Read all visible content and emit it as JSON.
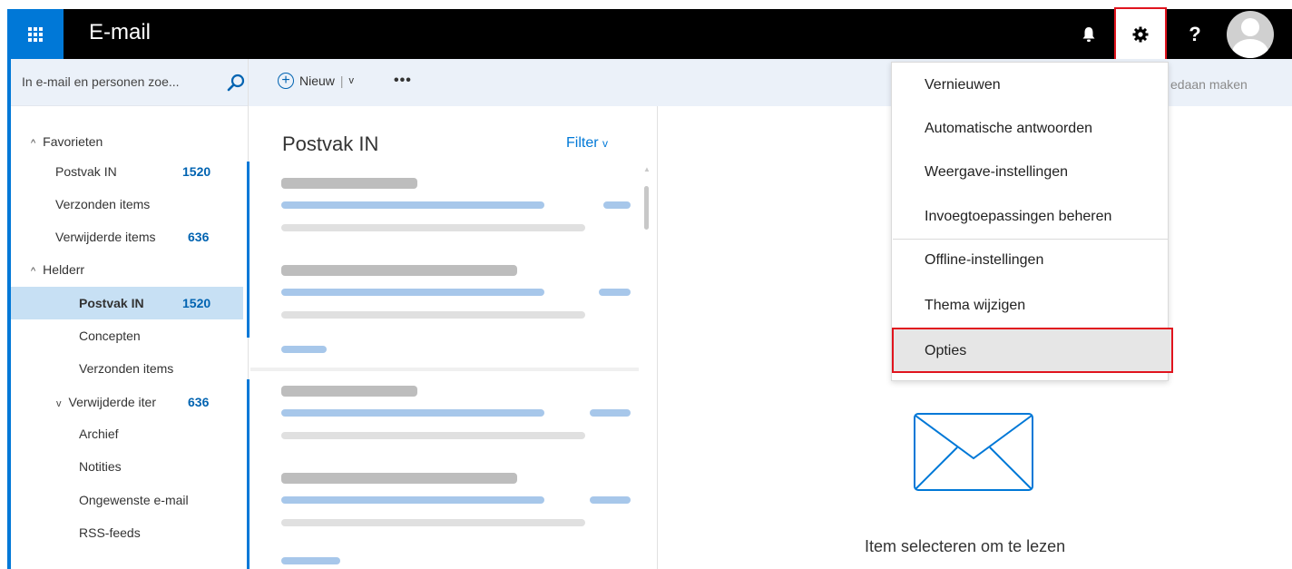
{
  "header": {
    "app_title": "E-mail",
    "icons": [
      "waffle-icon",
      "bell-icon",
      "gear-icon",
      "help-icon",
      "avatar-icon"
    ],
    "help_label": "?"
  },
  "search": {
    "placeholder": "In e-mail en personen zoe..."
  },
  "folders": {
    "favorites_label": "Favorieten",
    "favorites": [
      {
        "label": "Postvak IN",
        "count": "1520"
      },
      {
        "label": "Verzonden items",
        "count": ""
      },
      {
        "label": "Verwijderde items",
        "count": "636"
      }
    ],
    "account_label": "Helderr",
    "account": [
      {
        "label": "Postvak IN",
        "count": "1520"
      },
      {
        "label": "Concepten",
        "count": ""
      },
      {
        "label": "Verzonden items",
        "count": ""
      },
      {
        "label": "Verwijderde iter",
        "count": "636"
      },
      {
        "label": "Archief",
        "count": ""
      },
      {
        "label": "Notities",
        "count": ""
      },
      {
        "label": "Ongewenste e-mail",
        "count": ""
      },
      {
        "label": "RSS-feeds",
        "count": ""
      }
    ]
  },
  "commandbar": {
    "new_label": "Nieuw",
    "more_label": "•••",
    "undo_label": "edaan maken"
  },
  "message_list": {
    "title": "Postvak IN",
    "filter_label": "Filter"
  },
  "reading_pane": {
    "empty_text": "Item selecteren om te lezen"
  },
  "settings_menu": {
    "items": [
      "Vernieuwen",
      "Automatische antwoorden",
      "Weergave-instellingen",
      "Invoegtoepassingen beheren",
      "Offline-instellingen",
      "Thema wijzigen",
      "Opties"
    ],
    "highlighted": "Opties"
  },
  "colors": {
    "accent": "#0078d7",
    "highlight_border": "#e0141e",
    "selected_bg": "#c7e0f4"
  }
}
